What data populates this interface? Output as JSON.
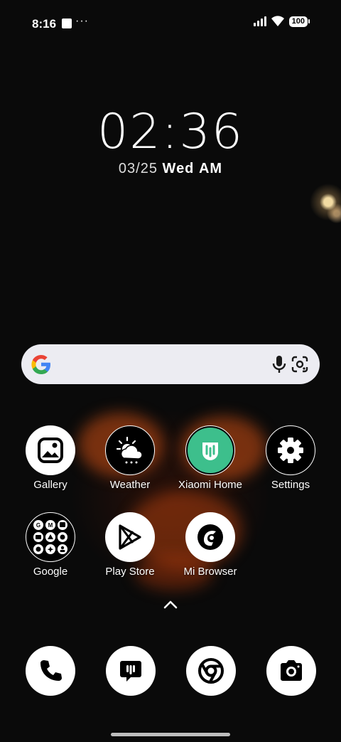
{
  "status_bar": {
    "time": "8:16",
    "overflow": "···",
    "battery": "100",
    "icons": [
      "square-notification-icon",
      "cellular-signal-icon",
      "wifi-icon",
      "battery-icon"
    ]
  },
  "clock": {
    "time": "02:36",
    "date": "03/25",
    "weekday": "Wed",
    "ampm": "AM"
  },
  "search_bar": {
    "icons": [
      "google-g-icon",
      "microphone-icon",
      "google-lens-icon"
    ]
  },
  "apps": [
    {
      "label": "Gallery",
      "icon": "gallery-icon"
    },
    {
      "label": "Weather",
      "icon": "weather-icon"
    },
    {
      "label": "Xiaomi Home",
      "icon": "xiaomi-home-icon",
      "color": "#3dbf8c"
    },
    {
      "label": "Settings",
      "icon": "gear-icon"
    },
    {
      "label": "Google",
      "icon": "google-folder-icon"
    },
    {
      "label": "Play Store",
      "icon": "play-store-icon"
    },
    {
      "label": "Mi Browser",
      "icon": "mi-browser-icon"
    }
  ],
  "dock": [
    {
      "icon": "phone-icon"
    },
    {
      "icon": "messages-icon"
    },
    {
      "icon": "chrome-icon"
    },
    {
      "icon": "camera-icon"
    }
  ]
}
